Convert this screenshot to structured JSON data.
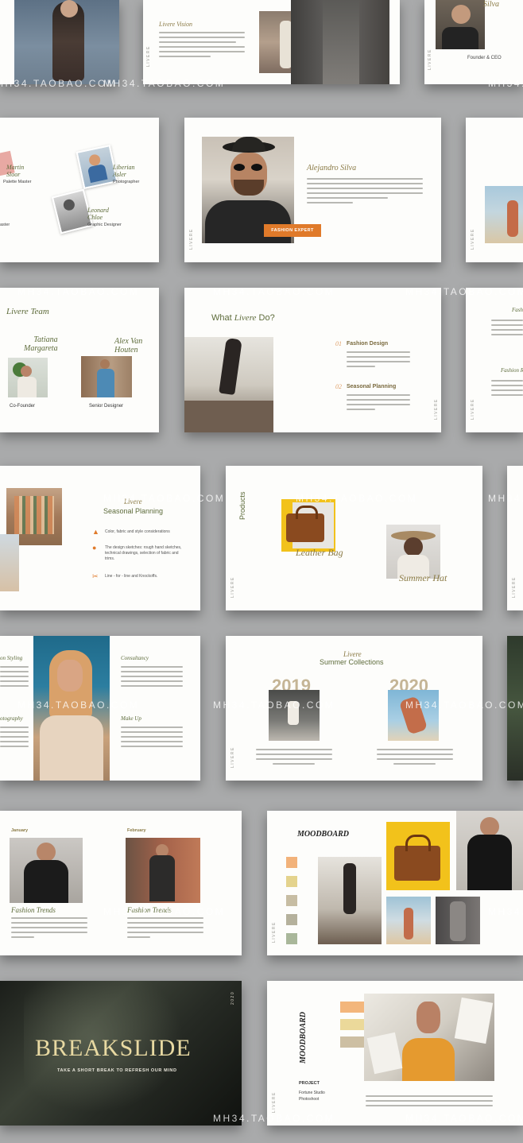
{
  "watermark": "MH34.TAOBAO.COM",
  "brand_vertical": "LIVERE",
  "colors": {
    "background": "#a9aaab",
    "accent_orange": "#e07a2a",
    "olive": "#5d6b3a",
    "gold": "#8a7a45",
    "swatches": [
      "#f2b27a",
      "#e4d38d",
      "#c7bda3",
      "#b5b19c",
      "#a9b79a"
    ],
    "moodboard_bars": [
      "#f3b67c",
      "#ebd99a",
      "#cdbfa3"
    ]
  },
  "slides": {
    "row1": {
      "vision_title": "Livere Vision",
      "founder_name": "Silva",
      "founder_role": "Founder & CEO"
    },
    "team_roles": {
      "martin": "Martin\nSloor",
      "martin_role": "Palette Master",
      "liberia": "Liberian\nAsler",
      "liberia_role": "Photographer",
      "leonard": "Leonard\nChloe",
      "leonard_role": "Graphic Designer",
      "master": "aster"
    },
    "fashion_expert": {
      "name": "Alejandro Silva",
      "badge": "FASHION EXPERT"
    },
    "team": {
      "title": "Livere Team",
      "member1_name": "Tatiana\nMargareta",
      "member1_role": "Co-Founder",
      "member2_name": "Alex Van\nHouten",
      "member2_role": "Senior Designer"
    },
    "what_do": {
      "title_prefix": "What",
      "title_italic": "Livere",
      "title_suffix": "Do?",
      "item1_num": "01",
      "item1_title": "Fashion Design",
      "item2_num": "02",
      "item2_title": "Seasonal Planning"
    },
    "right_partial": {
      "label1": "Fash",
      "label2": "Fashion R"
    },
    "seasonal": {
      "title_italic": "Livere",
      "title": "Seasonal Planning",
      "item1": "Color, fabric and style considerations",
      "item2": "The design sketches: rough hand sketches, technical drawings, selection of fabric and trims.",
      "item3": "Line - for - line and Knockoffs."
    },
    "products": {
      "heading": "Products",
      "product1": "Leather Bag",
      "product2": "Summer Hat"
    },
    "services": {
      "left1": "on Styling",
      "left2": "otography",
      "right1": "Consultancy",
      "right2": "Make Up"
    },
    "summer": {
      "title_italic": "Livere",
      "title": "Summer Collections",
      "year1": "2019",
      "year2": "2020"
    },
    "trends": {
      "month1": "January",
      "month2": "February",
      "title1": "Fashion Trends",
      "title2": "Fashion Trends"
    },
    "moodboard": {
      "title": "MOODBOARD"
    },
    "breakslide": {
      "title": "BREAKSLIDE",
      "subtitle": "TAKE A SHORT BREAK TO REFRESH OUR MIND",
      "year": "2020"
    },
    "moodboard2": {
      "title": "MOODBOARD",
      "project_label": "PROJECT",
      "project_line1": "Fortune Studio",
      "project_line2": "Photoshoot"
    }
  }
}
